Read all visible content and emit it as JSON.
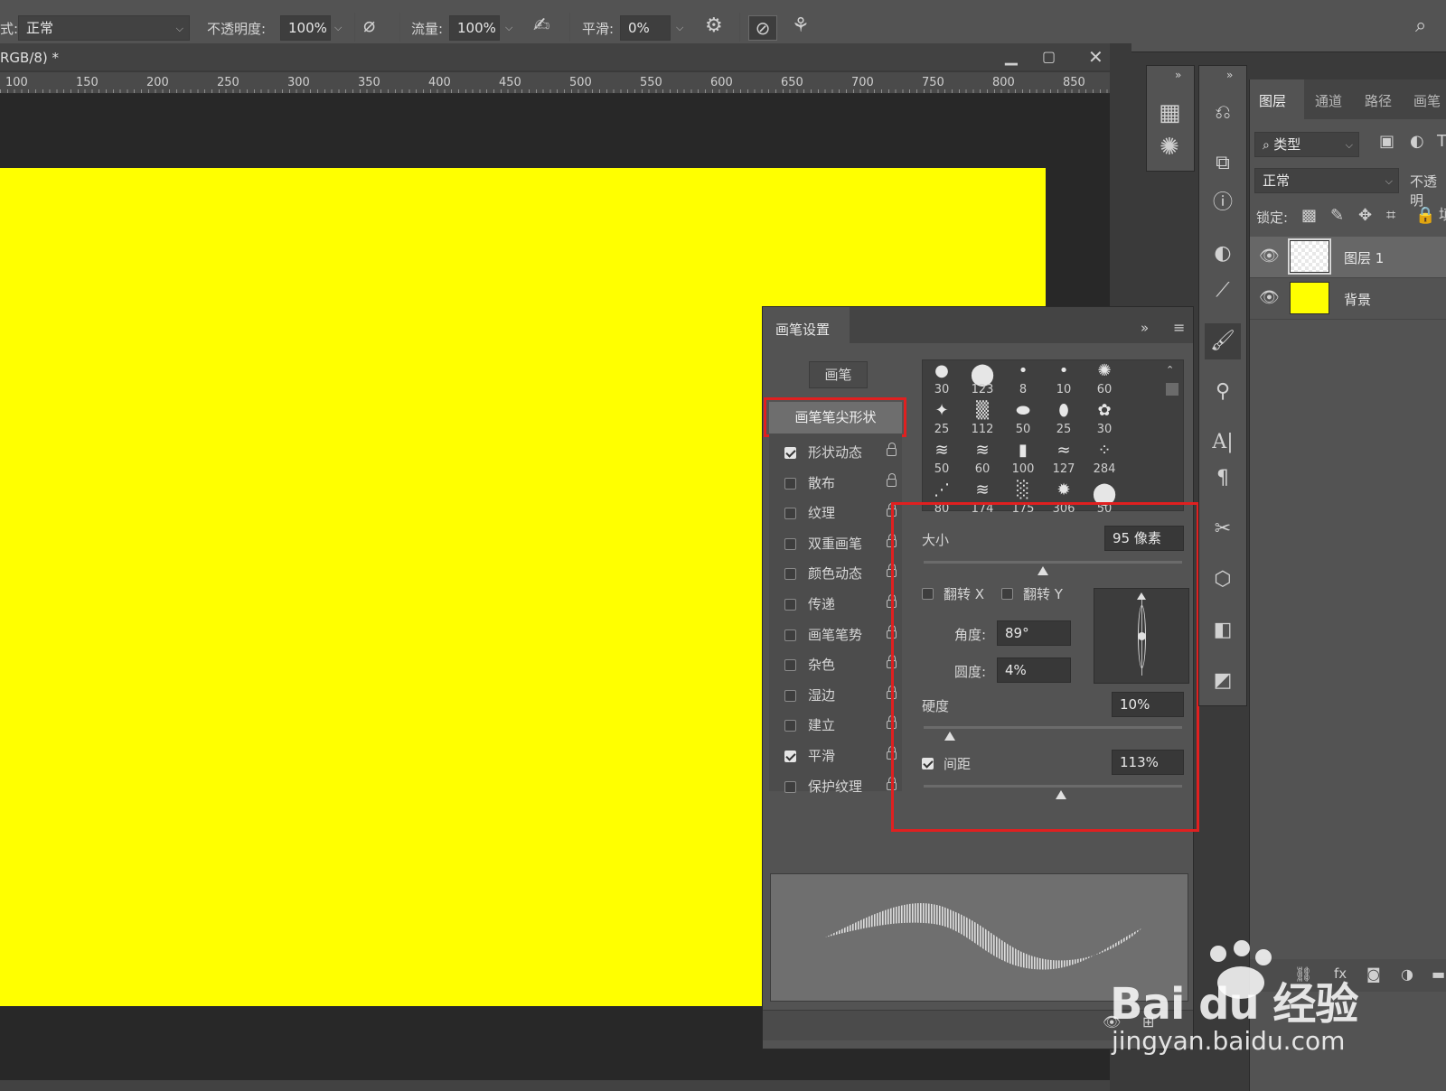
{
  "toolbar": {
    "mode_prefix": "式:",
    "mode_value": "正常",
    "opacity_label": "不透明度:",
    "opacity_value": "100%",
    "flow_label": "流量:",
    "flow_value": "100%",
    "smooth_label": "平滑:",
    "smooth_value": "0%"
  },
  "document": {
    "tab_title": "RGB/8) *",
    "canvas_color": "#ffff00",
    "ruler_labels": [
      "100",
      "150",
      "200",
      "250",
      "300",
      "350",
      "400",
      "450",
      "500",
      "550",
      "600",
      "650",
      "700",
      "750",
      "800",
      "850"
    ]
  },
  "brush_settings": {
    "title": "画笔设置",
    "brush_button": "画笔",
    "tip_shape_item": "画笔笔尖形状",
    "options": [
      {
        "label": "形状动态",
        "checked": true
      },
      {
        "label": "散布",
        "checked": false
      },
      {
        "label": "纹理",
        "checked": false
      },
      {
        "label": "双重画笔",
        "checked": false
      },
      {
        "label": "颜色动态",
        "checked": false
      },
      {
        "label": "传递",
        "checked": false
      },
      {
        "label": "画笔笔势",
        "checked": false
      },
      {
        "label": "杂色",
        "checked": false
      },
      {
        "label": "湿边",
        "checked": false
      },
      {
        "label": "建立",
        "checked": false
      },
      {
        "label": "平滑",
        "checked": true
      },
      {
        "label": "保护纹理",
        "checked": false
      }
    ],
    "presets": [
      "30",
      "123",
      "8",
      "10",
      "60",
      "25",
      "112",
      "50",
      "25",
      "30",
      "50",
      "60",
      "100",
      "127",
      "284",
      "80",
      "174",
      "175",
      "306",
      "50"
    ],
    "size_label": "大小",
    "size_value": "95 像素",
    "size_slider": 0.46,
    "flip_x_label": "翻转 X",
    "flip_y_label": "翻转 Y",
    "angle_label": "角度:",
    "angle_value": "89°",
    "roundness_label": "圆度:",
    "roundness_value": "4%",
    "hardness_label": "硬度",
    "hardness_value": "10%",
    "hardness_slider": 0.1,
    "spacing_label": "间距",
    "spacing_checked": true,
    "spacing_value": "113%",
    "spacing_slider": 0.53
  },
  "layers_panel": {
    "tabs": [
      "图层",
      "通道",
      "路径",
      "画笔"
    ],
    "filter_kind": "类型",
    "blend_mode": "正常",
    "opacity_label": "不透明",
    "lock_label": "锁定:",
    "layers": [
      {
        "name": "图层 1",
        "thumb": "transparent",
        "selected": true
      },
      {
        "name": "背景",
        "thumb": "#ffff00",
        "selected": false
      }
    ]
  },
  "watermark": {
    "brand": "Bai du 经验",
    "url": "jingyan.baidu.com"
  },
  "colors": {
    "highlight_red": "#e02020",
    "canvas_yellow": "#ffff00"
  }
}
